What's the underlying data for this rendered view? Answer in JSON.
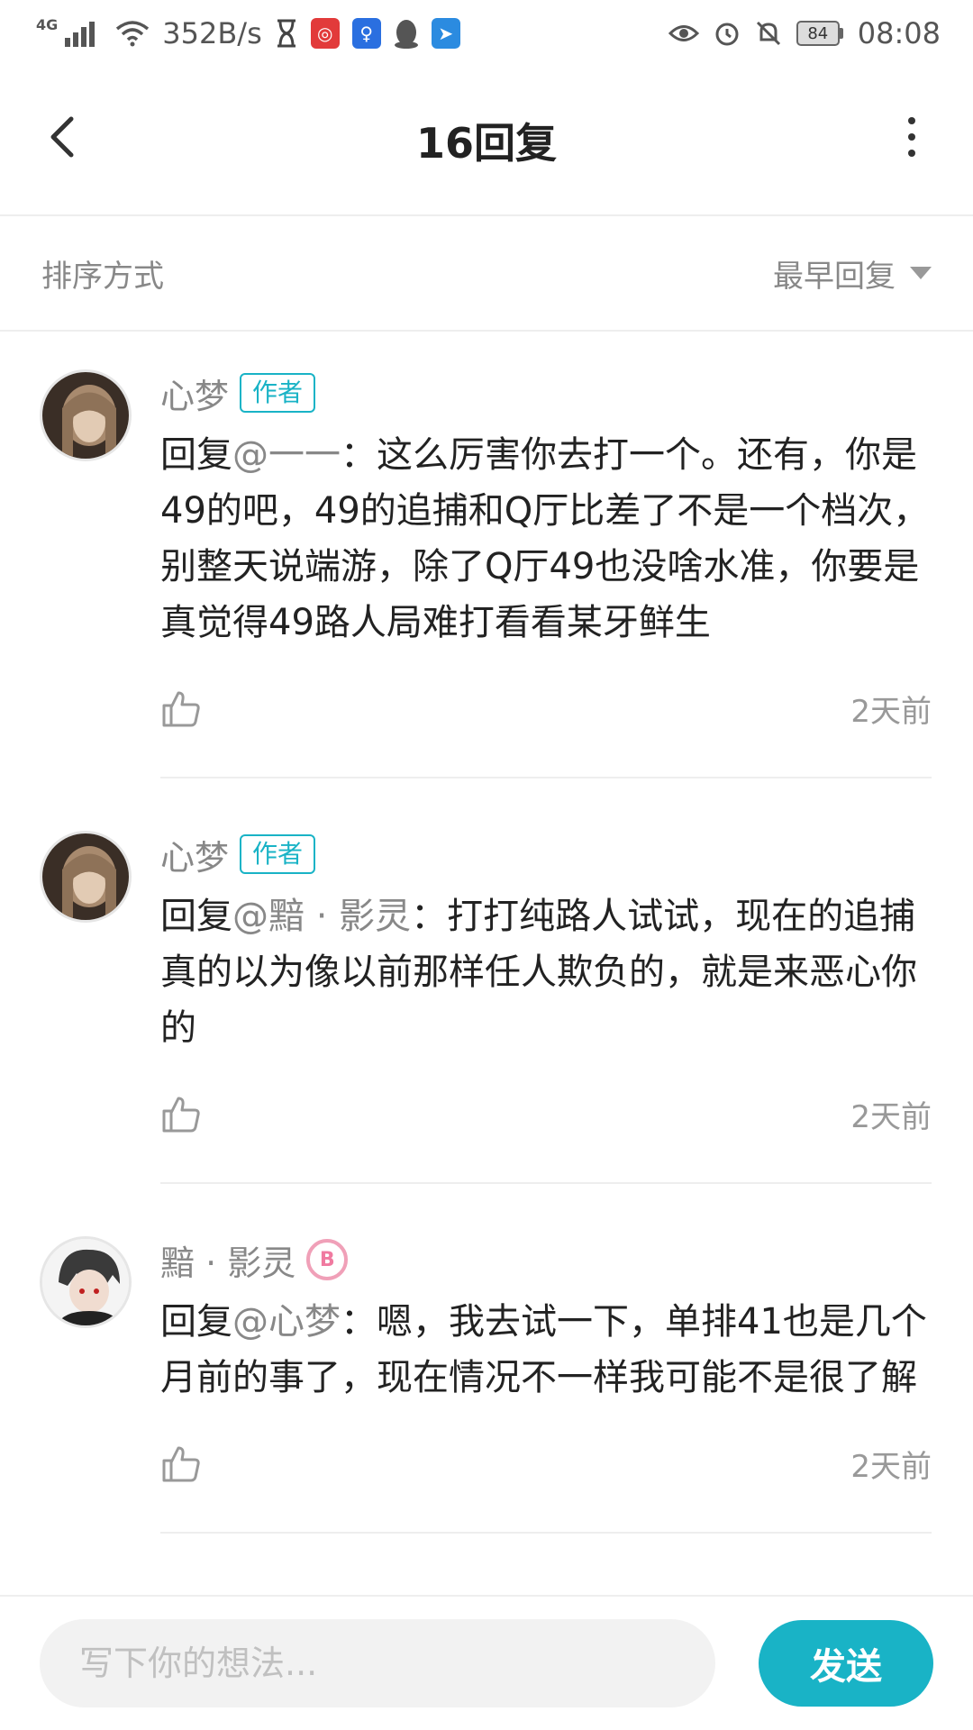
{
  "status_bar": {
    "network_type": "4G",
    "net_speed": "352B/s",
    "battery": "84",
    "time": "08:08"
  },
  "header": {
    "title": "16回复",
    "back_icon": "chevron-left-icon",
    "more_icon": "more-vertical-icon"
  },
  "sort": {
    "label": "排序方式",
    "selected": "最早回复"
  },
  "comments": [
    {
      "user": "心梦",
      "tag": "作者",
      "reply_prefix": "回复",
      "mention": "@一一",
      "colon": "：",
      "body": "这么厉害你去打一个。还有，你是49的吧，49的追捕和Q厅比差了不是一个档次，别整天说端游，除了Q厅49也没啥水准，你要是真觉得49路人局难打看看某牙鲜生",
      "time": "2天前"
    },
    {
      "user": "心梦",
      "tag": "作者",
      "reply_prefix": "回复",
      "mention": "@黯 · 影灵",
      "colon": "：",
      "body": "打打纯路人试试，现在的追捕真的以为像以前那样任人欺负的，就是来恶心你的",
      "time": "2天前"
    },
    {
      "user": "黯 · 影灵",
      "badge": "B",
      "reply_prefix": "回复",
      "mention": "@心梦",
      "colon": "：",
      "body": "嗯，我去试一下，单排41也是几个月前的事了，现在情况不一样我可能不是很了解",
      "time": "2天前"
    }
  ],
  "input": {
    "placeholder": "写下你的想法...",
    "send_label": "发送"
  },
  "colors": {
    "accent": "#19b3c6",
    "muted": "#888888",
    "badge_pink": "#f07aa0"
  }
}
